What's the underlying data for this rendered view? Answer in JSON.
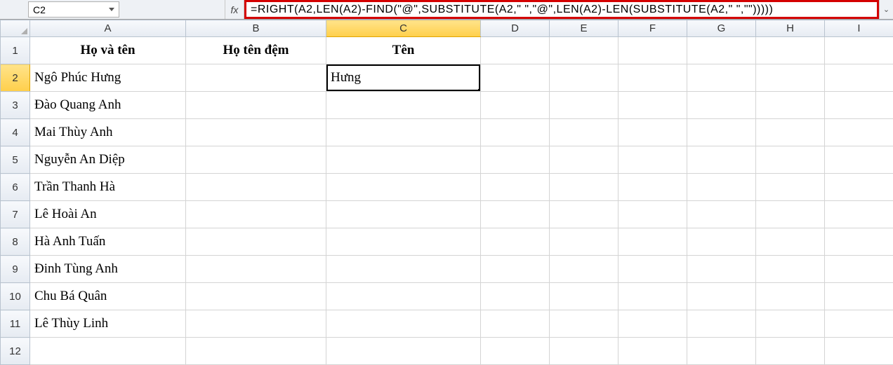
{
  "nameBox": "C2",
  "fxLabel": "fx",
  "formula": "=RIGHT(A2,LEN(A2)-FIND(\"@\",SUBSTITUTE(A2,\" \",\"@\",LEN(A2)-LEN(SUBSTITUTE(A2,\" \",\"\")))))",
  "columns": [
    "A",
    "B",
    "C",
    "D",
    "E",
    "F",
    "G",
    "H",
    "I"
  ],
  "activeCol": "C",
  "activeRow": 2,
  "rowCount": 12,
  "headers": {
    "A": "Họ và tên",
    "B": "Họ tên đệm",
    "C": "Tên"
  },
  "dataA": [
    "Ngô Phúc Hưng",
    "Đào Quang Anh",
    "Mai Thùy Anh",
    "Nguyễn An Diệp",
    "Trần Thanh Hà",
    "Lê Hoài An",
    "Hà Anh Tuấn",
    "Đinh Tùng Anh",
    "Chu Bá Quân",
    "Lê Thùy Linh"
  ],
  "activeCellValue": "Hưng"
}
